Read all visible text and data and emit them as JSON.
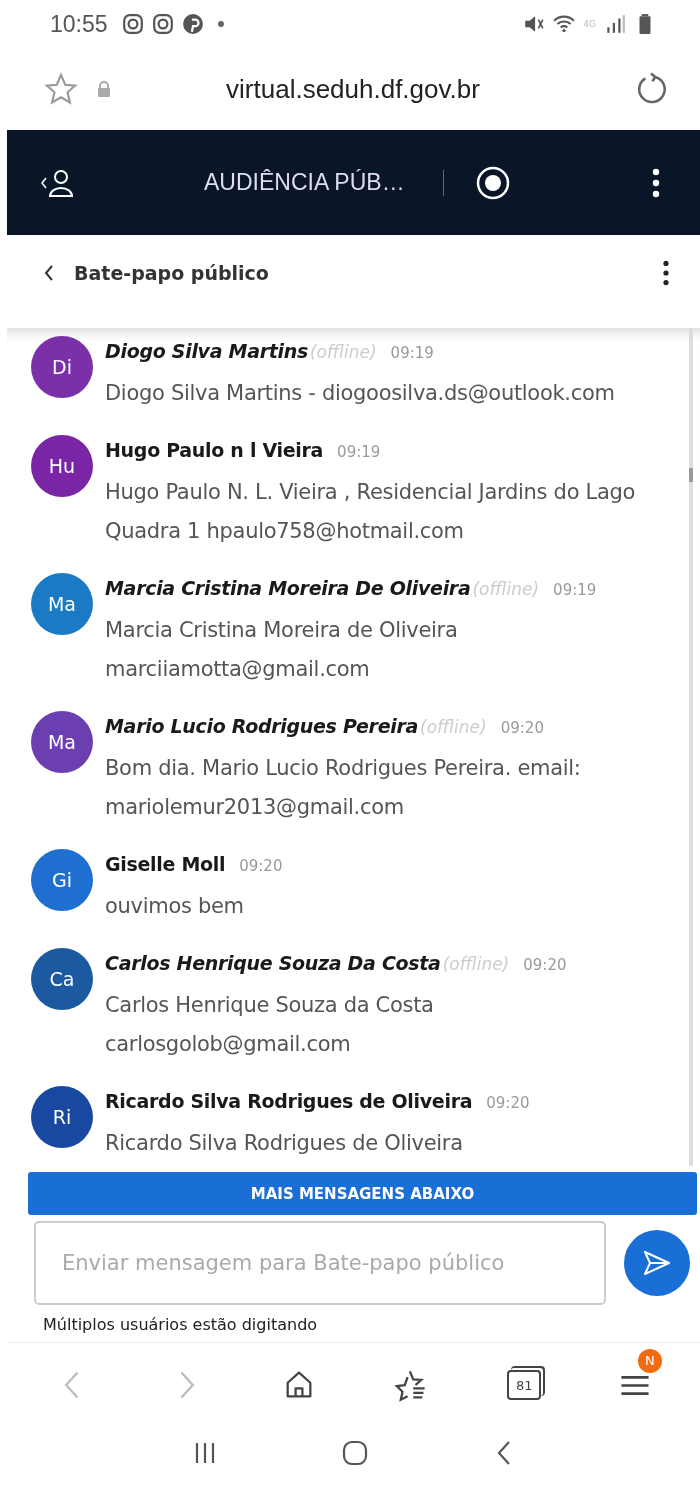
{
  "status_bar": {
    "time": "10:55",
    "network": "4G"
  },
  "browser": {
    "url": "virtual.seduh.df.gov.br"
  },
  "header": {
    "title": "AUDIÊNCIA PÚB…"
  },
  "chat": {
    "title": "Bate-papo público"
  },
  "messages": [
    {
      "initials": "Di",
      "color": "#7b2fa8",
      "name": "Diogo Silva Martins",
      "offline": true,
      "offline_label": "(offline)",
      "time": "09:19",
      "text": "Diogo Silva Martins - diogoosilva.ds@outlook.com"
    },
    {
      "initials": "Hu",
      "color": "#7a25a6",
      "name": "Hugo Paulo n l Vieira",
      "offline": false,
      "time": "09:19",
      "text": "Hugo Paulo N. L. Vieira , Residencial Jardins do Lago Quadra 1 hpaulo758@hotmail.com"
    },
    {
      "initials": "Ma",
      "color": "#1a7ac4",
      "name": "Marcia Cristina Moreira De Oliveira",
      "offline": true,
      "offline_label": "(offline)",
      "time": "09:19",
      "text": "Marcia Cristina Moreira de Oliveira marciiamotta@gmail.com"
    },
    {
      "initials": "Ma",
      "color": "#6b3fb0",
      "name": "Mario Lucio Rodrigues Pereira",
      "offline": true,
      "offline_label": "(offline)",
      "time": "09:20",
      "text": "Bom dia. Mario Lucio Rodrigues Pereira. email: mariolemur2013@gmail.com"
    },
    {
      "initials": "Gi",
      "color": "#1e6fcf",
      "name": "Giselle Moll",
      "offline": false,
      "time": "09:20",
      "text": "ouvimos bem"
    },
    {
      "initials": "Ca",
      "color": "#1b5aa0",
      "name": "Carlos Henrique Souza Da Costa",
      "offline": true,
      "offline_label": "(offline)",
      "time": "09:20",
      "text": "Carlos Henrique Souza da Costa carlosgolob@gmail.com"
    },
    {
      "initials": "Ri",
      "color": "#1848a0",
      "name": "Ricardo Silva Rodrigues de Oliveira",
      "offline": false,
      "time": "09:20",
      "text": "Ricardo Silva Rodrigues de Oliveira"
    }
  ],
  "more_button": "MAIS MENSAGENS ABAIXO",
  "composer": {
    "placeholder": "Enviar mensagem para Bate-papo público"
  },
  "typing": "Múltiplos usuários estão digitando",
  "browser_nav": {
    "tabs_count": "81",
    "menu_badge": "N"
  }
}
